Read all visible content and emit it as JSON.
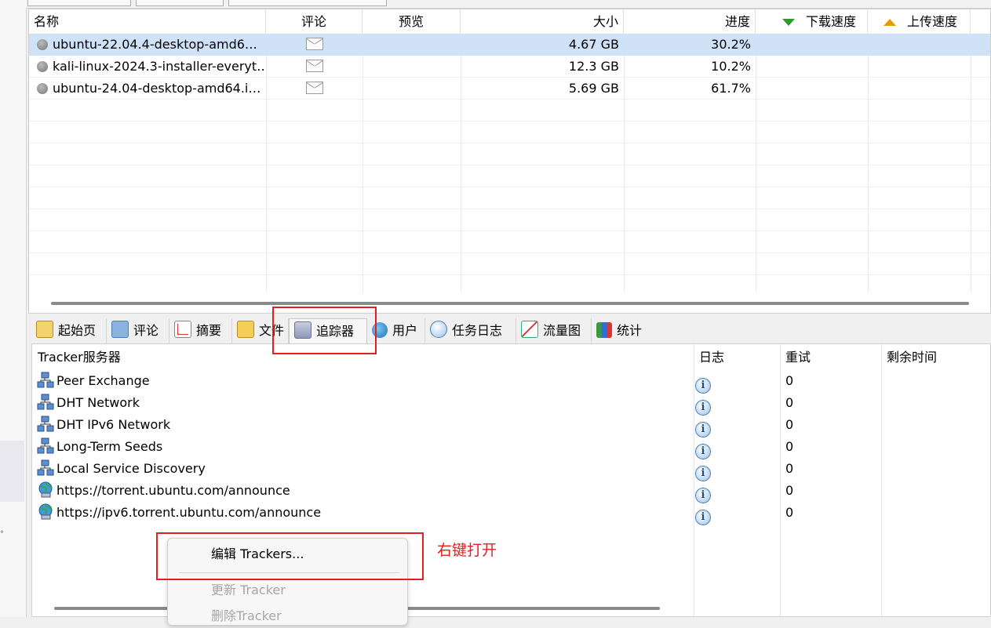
{
  "list": {
    "columns": [
      "名称",
      "评论",
      "预览",
      "大小",
      "进度",
      "下载速度",
      "上传速度"
    ],
    "rows": [
      {
        "name": "ubuntu-22.04.4-desktop-amd6…",
        "size": "4.67 GB",
        "progress": "30.2%"
      },
      {
        "name": "kali-linux-2024.3-installer-everyt…",
        "size": "12.3 GB",
        "progress": "10.2%"
      },
      {
        "name": "ubuntu-24.04-desktop-amd64.i…",
        "size": "5.69 GB",
        "progress": "61.7%"
      }
    ]
  },
  "tabs": [
    "起始页",
    "评论",
    "摘要",
    "文件",
    "追踪器",
    "用户",
    "任务日志",
    "流量图",
    "统计"
  ],
  "active_tab": "追踪器",
  "tracker": {
    "columns": [
      "Tracker服务器",
      "日志",
      "重试",
      "剩余时间"
    ],
    "rows": [
      {
        "name": "Peer Exchange",
        "retry": "0",
        "icon": "network-icon"
      },
      {
        "name": "DHT Network",
        "retry": "0",
        "icon": "network-icon"
      },
      {
        "name": "DHT IPv6 Network",
        "retry": "0",
        "icon": "network-icon"
      },
      {
        "name": "Long-Term Seeds",
        "retry": "0",
        "icon": "network-icon"
      },
      {
        "name": "Local Service Discovery",
        "retry": "0",
        "icon": "network-icon"
      },
      {
        "name": "https://torrent.ubuntu.com/announce",
        "retry": "0",
        "icon": "globe-icon"
      },
      {
        "name": "https://ipv6.torrent.ubuntu.com/announce",
        "retry": "0",
        "icon": "globe-icon"
      }
    ]
  },
  "context_menu": {
    "edit": "编辑 Trackers...",
    "update": "更新 Tracker",
    "delete": "删除Tracker"
  },
  "annotation": {
    "text": "右键打开",
    "color": "#e02020"
  }
}
